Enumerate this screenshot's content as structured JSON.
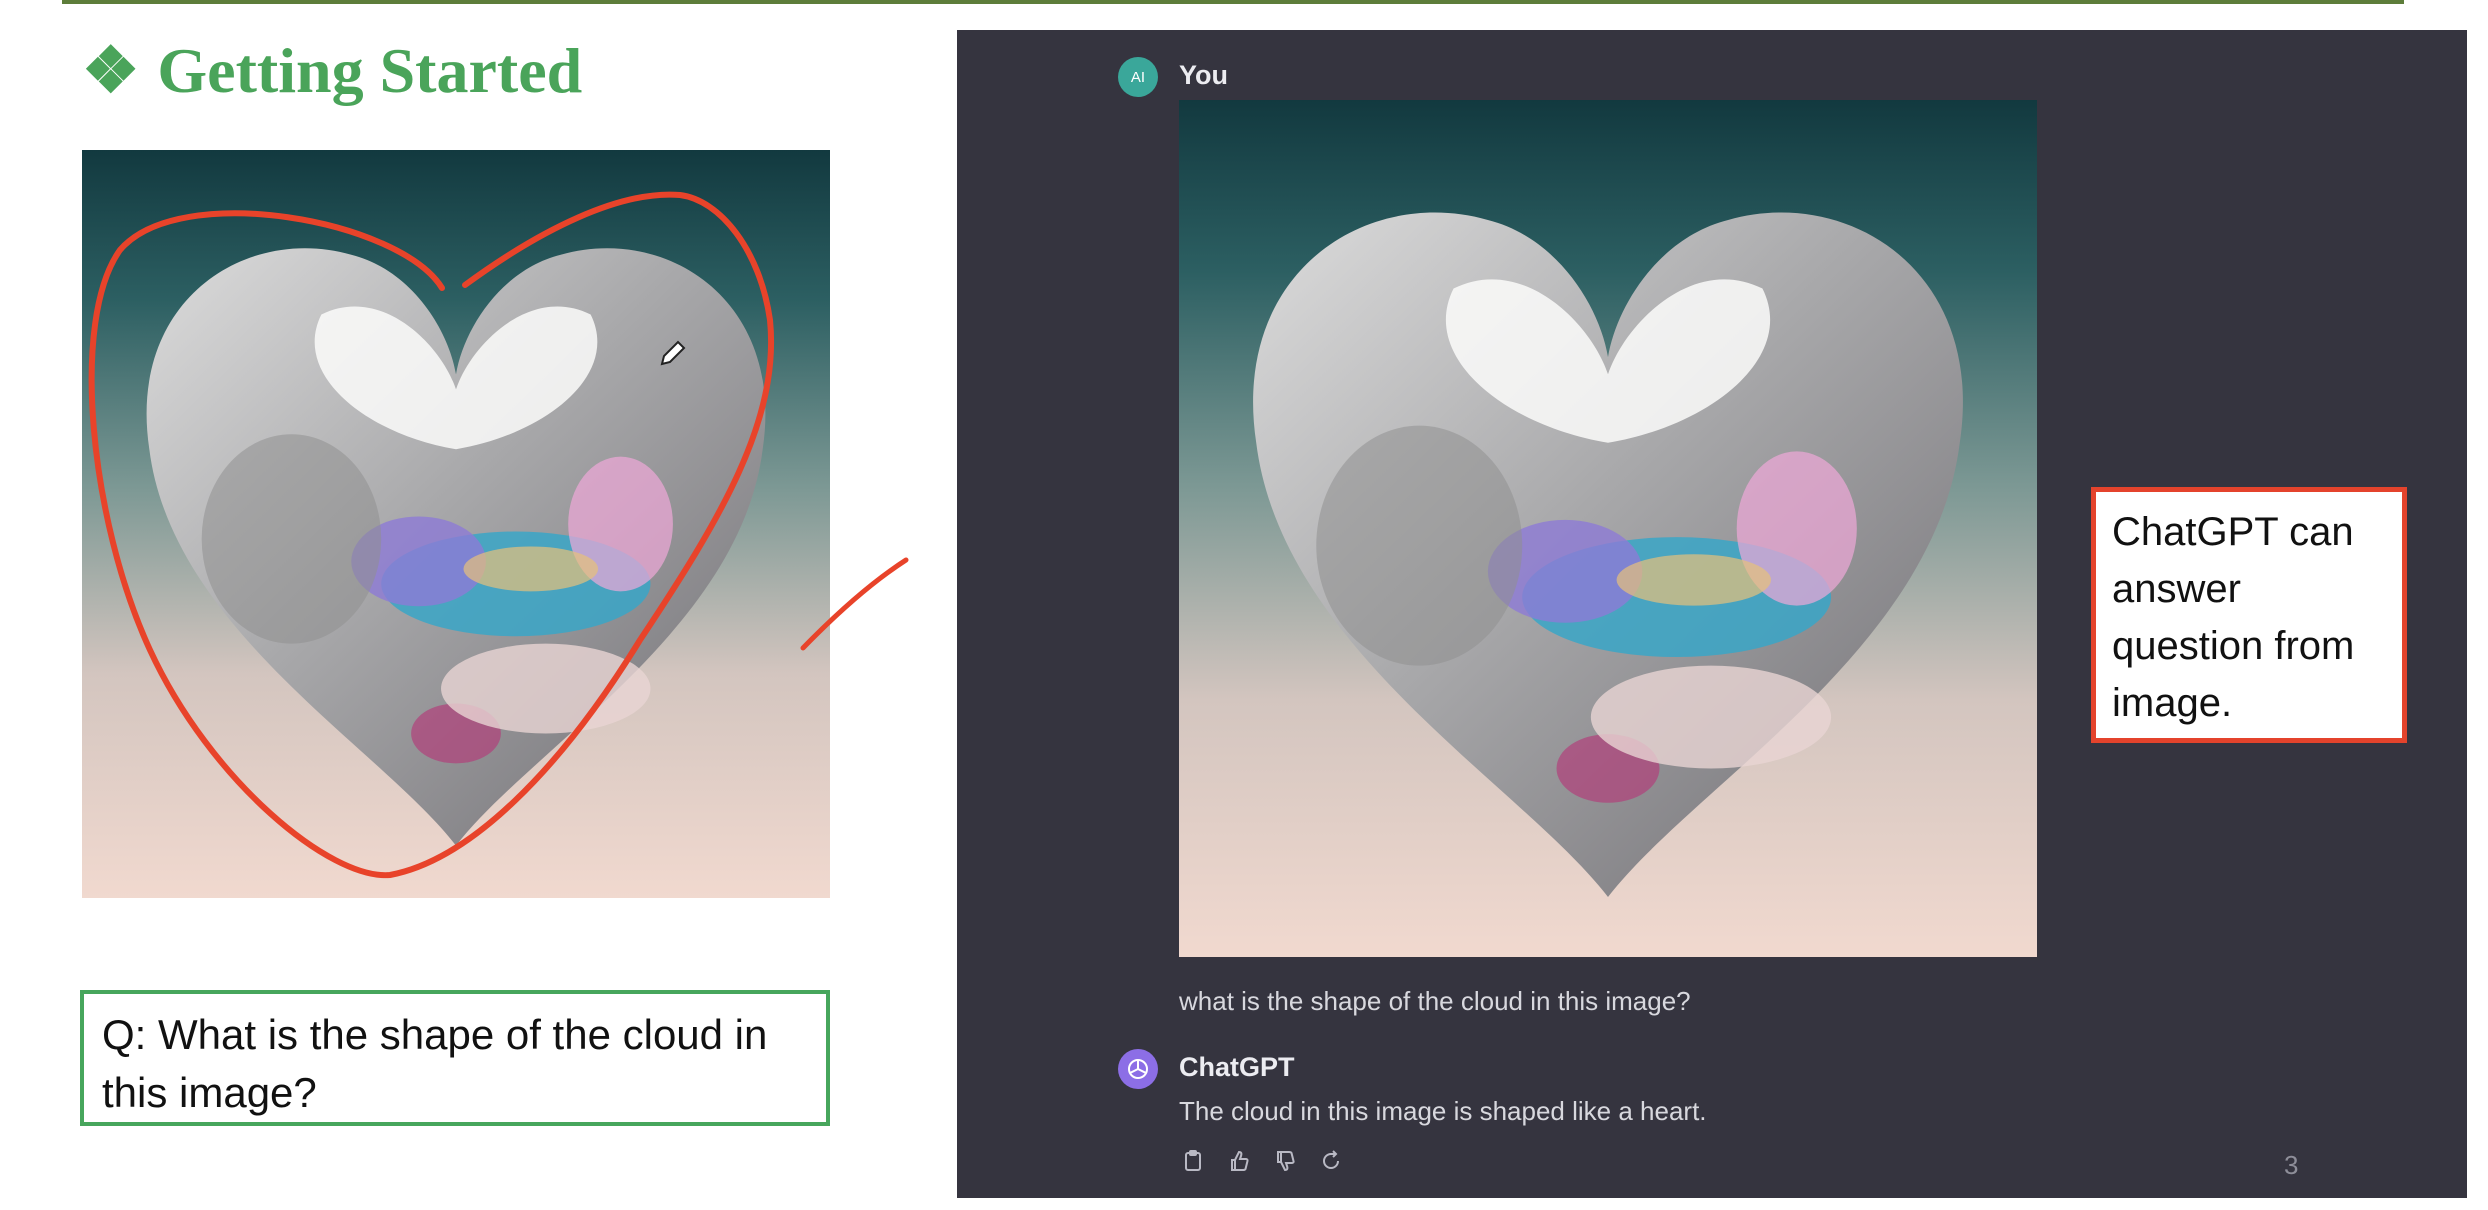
{
  "slide": {
    "title": "Getting Started",
    "title_bullet": "❖",
    "question_text": "Q: What is the shape of the cloud in this image?",
    "callout_text": "ChatGPT can answer question from image.",
    "page_number": "3"
  },
  "chat": {
    "user": {
      "avatar_initials": "AI",
      "name": "You",
      "message": "what is the shape of the cloud in this image?"
    },
    "assistant": {
      "avatar_icon": "openai-logo-icon",
      "name": "ChatGPT",
      "message": "The cloud in this image is shaped like a heart."
    },
    "actions": [
      {
        "name": "copy-icon"
      },
      {
        "name": "thumbs-up-icon"
      },
      {
        "name": "thumbs-down-icon"
      },
      {
        "name": "regenerate-icon"
      }
    ]
  },
  "colors": {
    "title_green": "#4aa45a",
    "question_border": "#47a65c",
    "callout_border": "#e4432c",
    "annotation_red": "#e8432a",
    "chat_background": "#35343f"
  }
}
